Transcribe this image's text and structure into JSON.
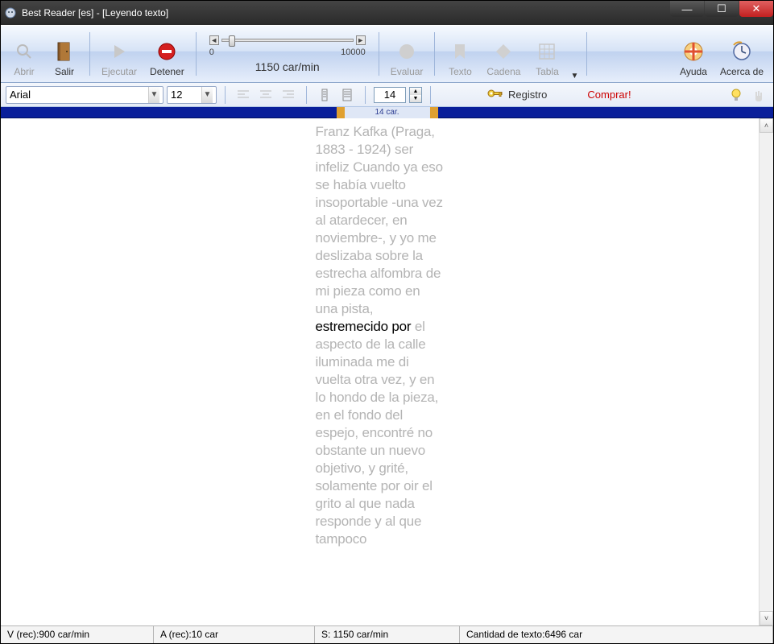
{
  "window": {
    "title": "Best Reader [es] - [Leyendo texto]"
  },
  "toolbar": {
    "abrir": "Abrir",
    "salir": "Salir",
    "ejecutar": "Ejecutar",
    "detener": "Detener",
    "evaluar": "Evaluar",
    "texto": "Texto",
    "cadena": "Cadena",
    "tabla": "Tabla",
    "ayuda": "Ayuda",
    "acerca": "Acerca de",
    "scale_min": "0",
    "scale_max": "10000",
    "speed_label": "1150 car/min"
  },
  "toolbar2": {
    "font": "Arial",
    "fontsize": "12",
    "chars": "14",
    "registro": "Registro",
    "comprar": "Comprar!"
  },
  "hint": {
    "label": "14 car."
  },
  "reader": {
    "pre": "Franz Kafka (Praga, 1883 - 1924)  ser infeliz Cuando ya eso se había vuelto insoportable -una vez al atardecer, en noviembre-, y yo me deslizaba sobre la estrecha alfombra de mi pieza como en una pista,",
    "highlight": "estremecido por",
    "post": "el aspecto de la calle iluminada me di vuelta otra vez, y en lo hondo de la pieza, en el fondo del espejo, encontré no obstante un nuevo objetivo, y grité, solamente por oir el grito al que nada responde y al que tampoco"
  },
  "status": {
    "v": "V (rec):900 car/min",
    "a": "A (rec):10 car",
    "s": "S: 1150 car/min",
    "count": "Cantidad de texto:6496 car"
  }
}
